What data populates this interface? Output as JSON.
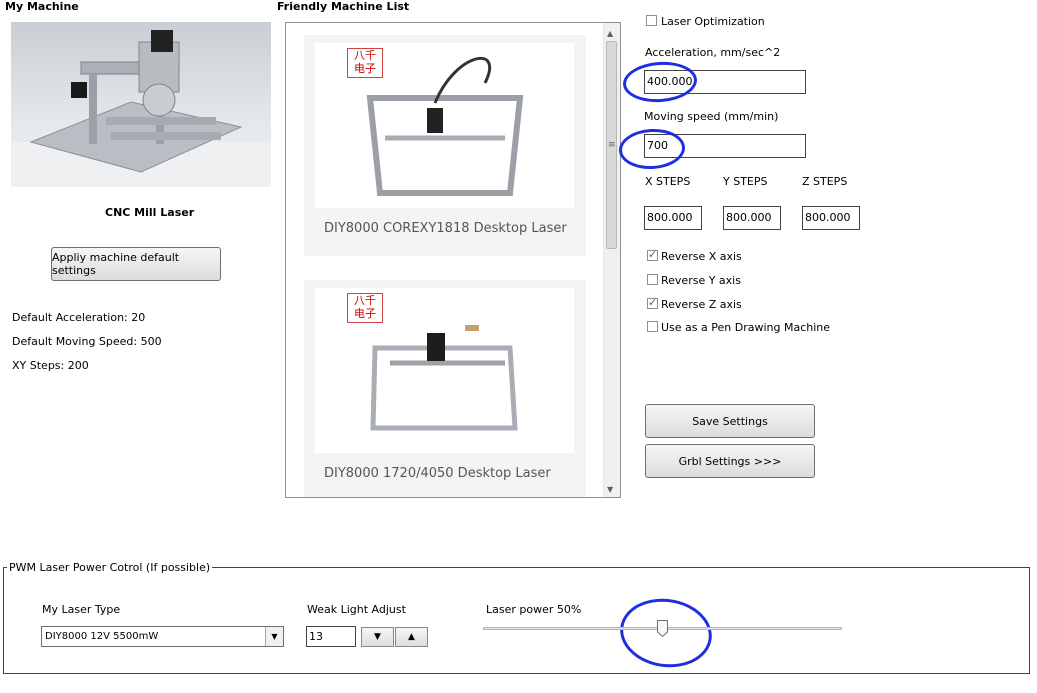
{
  "my_machine": {
    "title": "My Machine",
    "machine_name": "CNC Mill Laser",
    "apply_button_label": "Appliy machine default settings",
    "default_acceleration": "Default Acceleration: 20",
    "default_moving_speed": "Default Moving Speed: 500",
    "xy_steps": "XY Steps: 200"
  },
  "friendly_list": {
    "title": "Friendly Machine List",
    "items": [
      {
        "badge": "八千\n电子",
        "caption": "DIY8000 COREXY1818 Desktop Laser"
      },
      {
        "badge": "八千\n电子",
        "caption": "DIY8000 1720/4050 Desktop Laser"
      }
    ]
  },
  "settings": {
    "laser_optimization_label": "Laser Optimization",
    "laser_optimization_checked": false,
    "acceleration_label": "Acceleration, mm/sec^2",
    "acceleration_value": "400.000",
    "moving_speed_label": "Moving speed  (mm/min)",
    "moving_speed_value": "700",
    "x_steps_label": "X STEPS",
    "y_steps_label": "Y STEPS",
    "z_steps_label": "Z STEPS",
    "x_steps_value": "800.000",
    "y_steps_value": "800.000",
    "z_steps_value": "800.000",
    "reverse_x_label": "Reverse X axis",
    "reverse_x_checked": true,
    "reverse_y_label": "Reverse Y axis",
    "reverse_y_checked": false,
    "reverse_z_label": "Reverse Z axis",
    "reverse_z_checked": true,
    "pen_mode_label": "Use as a Pen Drawing Machine",
    "pen_mode_checked": false,
    "save_button_label": "Save Settings",
    "grbl_button_label": "Grbl Settings >>>"
  },
  "pwm": {
    "group_title": "PWM Laser Power Cotrol (If possible)",
    "laser_type_label": "My Laser Type",
    "laser_type_value": "DIY8000 12V 5500mW",
    "weak_light_label": "Weak Light Adjust",
    "weak_light_value": "13",
    "laser_power_label": "Laser power 50%",
    "laser_power_fraction": 0.5
  },
  "colors": {
    "annotation_blue": "#1f2ee0",
    "check_green": "#2e7d32"
  }
}
